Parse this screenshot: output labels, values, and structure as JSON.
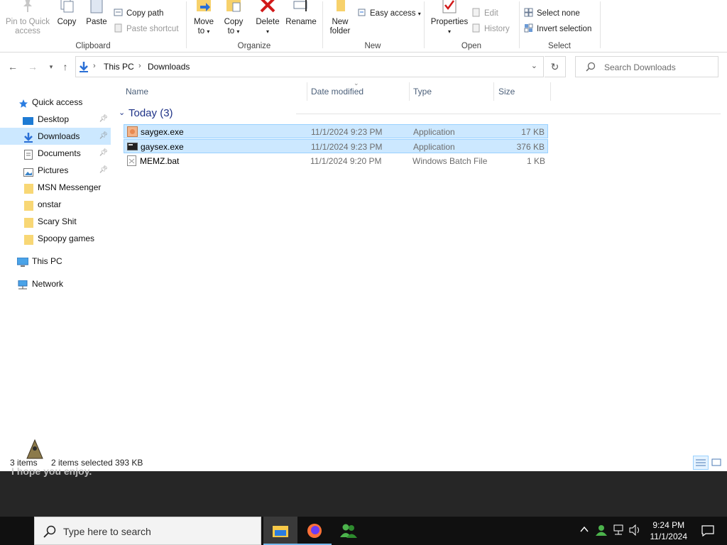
{
  "ribbon": {
    "clipboard": {
      "label": "Clipboard",
      "pin_label_1": "Pin to Quick",
      "pin_label_2": "access",
      "copy_label": "Copy",
      "paste_label": "Paste",
      "copy_path_label": "Copy path",
      "paste_shortcut_label": "Paste shortcut"
    },
    "organize": {
      "label": "Organize",
      "move_to_1": "Move",
      "move_to_2": "to",
      "copy_to_1": "Copy",
      "copy_to_2": "to",
      "delete_label": "Delete",
      "rename_label": "Rename"
    },
    "new": {
      "label": "New",
      "new_folder_1": "New",
      "new_folder_2": "folder",
      "easy_access_label": "Easy access"
    },
    "open": {
      "label": "Open",
      "properties_label": "Properties",
      "edit_label": "Edit",
      "history_label": "History"
    },
    "select": {
      "label": "Select",
      "select_none_label": "Select none",
      "invert_selection_label": "Invert selection"
    }
  },
  "address": {
    "crumbs": [
      "This PC",
      "Downloads"
    ],
    "search_placeholder": "Search Downloads"
  },
  "navpane": {
    "quick_access": "Quick access",
    "items": [
      {
        "label": "Desktop",
        "pinned": true
      },
      {
        "label": "Downloads",
        "pinned": true,
        "selected": true
      },
      {
        "label": "Documents",
        "pinned": true
      },
      {
        "label": "Pictures",
        "pinned": true
      },
      {
        "label": "MSN Messenger",
        "pinned": false
      },
      {
        "label": "onstar",
        "pinned": false
      },
      {
        "label": "Scary Shit",
        "pinned": false
      },
      {
        "label": "Spoopy games",
        "pinned": false
      }
    ],
    "this_pc": "This PC",
    "network": "Network"
  },
  "filelist": {
    "columns": [
      "Name",
      "Date modified",
      "Type",
      "Size"
    ],
    "group_title": "Today (3)",
    "files": [
      {
        "name": "saygex.exe",
        "date": "11/1/2024 9:23 PM",
        "type": "Application",
        "size": "17 KB",
        "selected": true
      },
      {
        "name": "gaysex.exe",
        "date": "11/1/2024 9:23 PM",
        "type": "Application",
        "size": "376 KB",
        "selected": true
      },
      {
        "name": "MEMZ.bat",
        "date": "11/1/2024 9:20 PM",
        "type": "Windows Batch File",
        "size": "1 KB",
        "selected": false
      }
    ]
  },
  "status": {
    "item_count": "3 items",
    "selection": "2 items selected  393 KB"
  },
  "desktop": {
    "overlay_text": "I hope you enjoy."
  },
  "taskbar": {
    "search_placeholder": "Type here to search",
    "time": "9:24 PM",
    "date": "11/1/2024"
  },
  "colors": {
    "selection_bg": "#cce8ff",
    "selection_border": "#99d1ff",
    "group_heading": "#1e3287",
    "header_text": "#4c607a",
    "taskbar_bg": "#101010"
  }
}
